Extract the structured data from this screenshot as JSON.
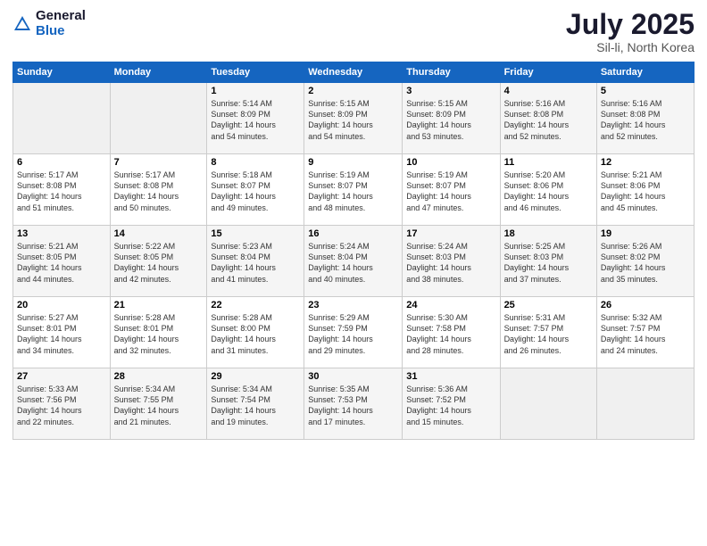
{
  "logo": {
    "general": "General",
    "blue": "Blue"
  },
  "title": "July 2025",
  "location": "Sil-li, North Korea",
  "days_of_week": [
    "Sunday",
    "Monday",
    "Tuesday",
    "Wednesday",
    "Thursday",
    "Friday",
    "Saturday"
  ],
  "weeks": [
    [
      {
        "day": "",
        "content": ""
      },
      {
        "day": "",
        "content": ""
      },
      {
        "day": "1",
        "content": "Sunrise: 5:14 AM\nSunset: 8:09 PM\nDaylight: 14 hours\nand 54 minutes."
      },
      {
        "day": "2",
        "content": "Sunrise: 5:15 AM\nSunset: 8:09 PM\nDaylight: 14 hours\nand 54 minutes."
      },
      {
        "day": "3",
        "content": "Sunrise: 5:15 AM\nSunset: 8:09 PM\nDaylight: 14 hours\nand 53 minutes."
      },
      {
        "day": "4",
        "content": "Sunrise: 5:16 AM\nSunset: 8:08 PM\nDaylight: 14 hours\nand 52 minutes."
      },
      {
        "day": "5",
        "content": "Sunrise: 5:16 AM\nSunset: 8:08 PM\nDaylight: 14 hours\nand 52 minutes."
      }
    ],
    [
      {
        "day": "6",
        "content": "Sunrise: 5:17 AM\nSunset: 8:08 PM\nDaylight: 14 hours\nand 51 minutes."
      },
      {
        "day": "7",
        "content": "Sunrise: 5:17 AM\nSunset: 8:08 PM\nDaylight: 14 hours\nand 50 minutes."
      },
      {
        "day": "8",
        "content": "Sunrise: 5:18 AM\nSunset: 8:07 PM\nDaylight: 14 hours\nand 49 minutes."
      },
      {
        "day": "9",
        "content": "Sunrise: 5:19 AM\nSunset: 8:07 PM\nDaylight: 14 hours\nand 48 minutes."
      },
      {
        "day": "10",
        "content": "Sunrise: 5:19 AM\nSunset: 8:07 PM\nDaylight: 14 hours\nand 47 minutes."
      },
      {
        "day": "11",
        "content": "Sunrise: 5:20 AM\nSunset: 8:06 PM\nDaylight: 14 hours\nand 46 minutes."
      },
      {
        "day": "12",
        "content": "Sunrise: 5:21 AM\nSunset: 8:06 PM\nDaylight: 14 hours\nand 45 minutes."
      }
    ],
    [
      {
        "day": "13",
        "content": "Sunrise: 5:21 AM\nSunset: 8:05 PM\nDaylight: 14 hours\nand 44 minutes."
      },
      {
        "day": "14",
        "content": "Sunrise: 5:22 AM\nSunset: 8:05 PM\nDaylight: 14 hours\nand 42 minutes."
      },
      {
        "day": "15",
        "content": "Sunrise: 5:23 AM\nSunset: 8:04 PM\nDaylight: 14 hours\nand 41 minutes."
      },
      {
        "day": "16",
        "content": "Sunrise: 5:24 AM\nSunset: 8:04 PM\nDaylight: 14 hours\nand 40 minutes."
      },
      {
        "day": "17",
        "content": "Sunrise: 5:24 AM\nSunset: 8:03 PM\nDaylight: 14 hours\nand 38 minutes."
      },
      {
        "day": "18",
        "content": "Sunrise: 5:25 AM\nSunset: 8:03 PM\nDaylight: 14 hours\nand 37 minutes."
      },
      {
        "day": "19",
        "content": "Sunrise: 5:26 AM\nSunset: 8:02 PM\nDaylight: 14 hours\nand 35 minutes."
      }
    ],
    [
      {
        "day": "20",
        "content": "Sunrise: 5:27 AM\nSunset: 8:01 PM\nDaylight: 14 hours\nand 34 minutes."
      },
      {
        "day": "21",
        "content": "Sunrise: 5:28 AM\nSunset: 8:01 PM\nDaylight: 14 hours\nand 32 minutes."
      },
      {
        "day": "22",
        "content": "Sunrise: 5:28 AM\nSunset: 8:00 PM\nDaylight: 14 hours\nand 31 minutes."
      },
      {
        "day": "23",
        "content": "Sunrise: 5:29 AM\nSunset: 7:59 PM\nDaylight: 14 hours\nand 29 minutes."
      },
      {
        "day": "24",
        "content": "Sunrise: 5:30 AM\nSunset: 7:58 PM\nDaylight: 14 hours\nand 28 minutes."
      },
      {
        "day": "25",
        "content": "Sunrise: 5:31 AM\nSunset: 7:57 PM\nDaylight: 14 hours\nand 26 minutes."
      },
      {
        "day": "26",
        "content": "Sunrise: 5:32 AM\nSunset: 7:57 PM\nDaylight: 14 hours\nand 24 minutes."
      }
    ],
    [
      {
        "day": "27",
        "content": "Sunrise: 5:33 AM\nSunset: 7:56 PM\nDaylight: 14 hours\nand 22 minutes."
      },
      {
        "day": "28",
        "content": "Sunrise: 5:34 AM\nSunset: 7:55 PM\nDaylight: 14 hours\nand 21 minutes."
      },
      {
        "day": "29",
        "content": "Sunrise: 5:34 AM\nSunset: 7:54 PM\nDaylight: 14 hours\nand 19 minutes."
      },
      {
        "day": "30",
        "content": "Sunrise: 5:35 AM\nSunset: 7:53 PM\nDaylight: 14 hours\nand 17 minutes."
      },
      {
        "day": "31",
        "content": "Sunrise: 5:36 AM\nSunset: 7:52 PM\nDaylight: 14 hours\nand 15 minutes."
      },
      {
        "day": "",
        "content": ""
      },
      {
        "day": "",
        "content": ""
      }
    ]
  ]
}
